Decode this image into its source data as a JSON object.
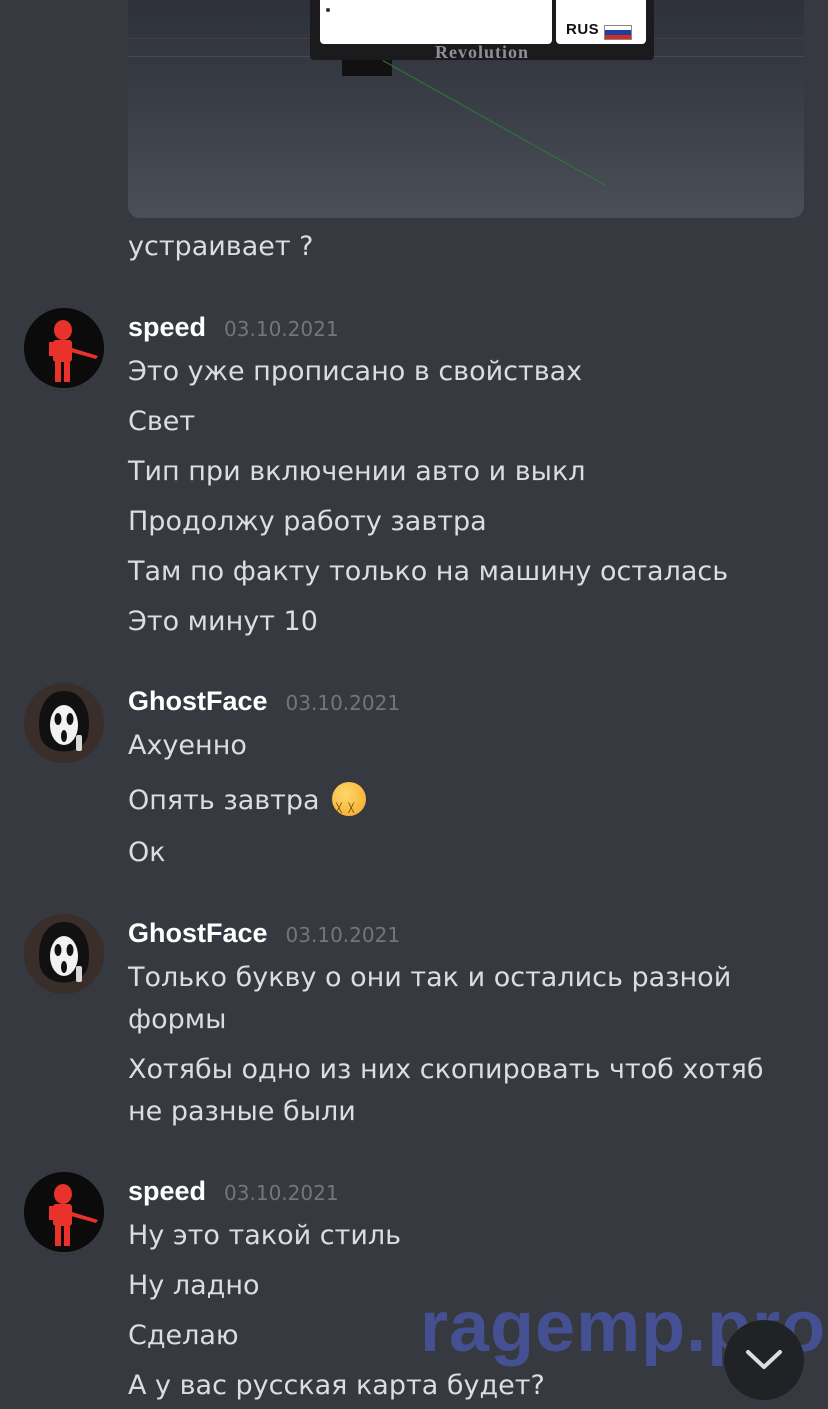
{
  "embed": {
    "plate_region": "RUS",
    "plate_brand": "Revolution",
    "caption": "устраивает ?"
  },
  "messages": [
    {
      "username": "speed",
      "timestamp": "03.10.2021",
      "avatar_icon": "speed-avatar-red-figure-icon",
      "lines": [
        "Это уже прописано в свойствах",
        "Свет",
        "Тип при включении авто и выкл",
        "Продолжу работу завтра",
        "Там по факту только на машину осталась",
        "Это минут 10"
      ]
    },
    {
      "username": "GhostFace",
      "timestamp": "03.10.2021",
      "avatar_icon": "ghostface-mask-avatar-icon",
      "lines": [
        "Ахуенно",
        "Опять завтра",
        "Ок"
      ],
      "emoji": "tired-face-emoji-icon"
    },
    {
      "username": "GhostFace",
      "timestamp": "03.10.2021",
      "avatar_icon": "ghostface-mask-avatar-icon",
      "lines": [
        "Только букву о они так и остались разной формы",
        "Хотябы одно из них скопировать чтоб хотяб не разные были"
      ]
    },
    {
      "username": "speed",
      "timestamp": "03.10.2021",
      "avatar_icon": "speed-avatar-red-figure-icon",
      "lines": [
        "Ну это такой стиль",
        "Ну ладно",
        "Сделаю",
        "А у вас русская карта будет?"
      ]
    }
  ],
  "watermark": "ragemp.pro",
  "jump_button_icon": "chevron-down-icon",
  "colors": {
    "background": "#36393f",
    "username": "#ffffff",
    "text": "#dcddde",
    "timestamp": "#72767d",
    "watermark": "#4655a0",
    "jump_button": "#202225"
  }
}
